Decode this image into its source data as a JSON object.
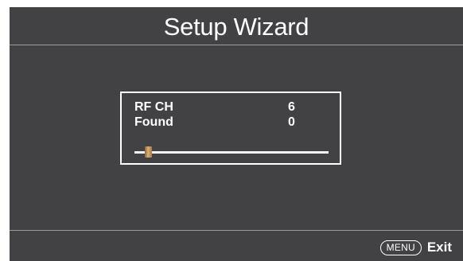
{
  "header": {
    "title": "Setup Wizard"
  },
  "scan": {
    "rows": [
      {
        "label": "RF CH",
        "value": "6"
      },
      {
        "label": "Found",
        "value": "0"
      }
    ],
    "progress_fraction": 0.07
  },
  "footer": {
    "menu_key": "MENU",
    "exit_label": "Exit"
  },
  "colors": {
    "panel_bg": "#424245",
    "text": "#ffffff",
    "progress_handle": "#c79a5c"
  }
}
